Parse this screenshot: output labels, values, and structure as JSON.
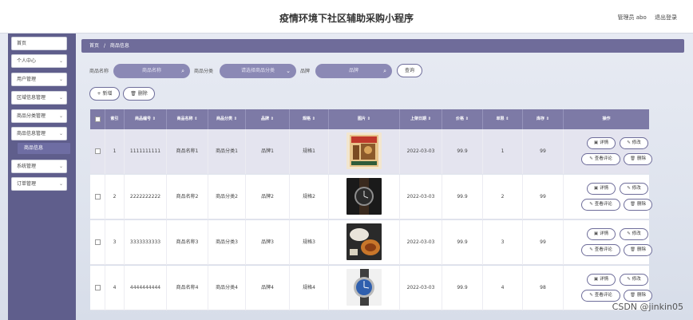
{
  "app": {
    "title": "疫情环境下社区辅助采购小程序",
    "admin": "管理员 abo",
    "logout": "退出登录"
  },
  "sidebar": {
    "items": [
      {
        "label": "首页",
        "chevron": ""
      },
      {
        "label": "个人中心",
        "chevron": "⌄"
      },
      {
        "label": "用户管理",
        "chevron": "⌄"
      },
      {
        "label": "区域信息管理",
        "chevron": "⌄"
      },
      {
        "label": "商品分类管理",
        "chevron": "⌄"
      },
      {
        "label": "商品信息管理",
        "chevron": "⌄"
      },
      {
        "label": "系统管理",
        "chevron": "⌄"
      },
      {
        "label": "订单管理",
        "chevron": "⌄"
      }
    ],
    "active_sub": "商品信息"
  },
  "breadcrumb": {
    "home": "首页",
    "sep": "/",
    "current": "商品信息"
  },
  "search": {
    "name_label": "商品名称",
    "name_placeholder": "商品名称",
    "cat_label": "商品分类",
    "cat_placeholder": "请选择商品分类",
    "brand_label": "品牌",
    "brand_placeholder": "品牌",
    "query": "查询",
    "search_icon": "⌕",
    "dropdown_icon": "⌄"
  },
  "actions": {
    "add": "+ 新增",
    "delete": "删除"
  },
  "table": {
    "headers": [
      "",
      "索引",
      "商品编号 ⇕",
      "商品名称 ⇕",
      "商品分类 ⇕",
      "品牌 ⇕",
      "规格 ⇕",
      "图片 ⇕",
      "上架日期 ⇕",
      "价格 ⇕",
      "单限 ⇕",
      "库存 ⇕",
      "操作"
    ],
    "rows": [
      {
        "index": "1",
        "code": "1111111111",
        "name": "商品名称1",
        "category": "商品分类1",
        "brand": "品牌1",
        "spec": "规格1",
        "date": "2022-03-03",
        "price": "99.9",
        "limit": "1",
        "stock": "99",
        "image": "book"
      },
      {
        "index": "2",
        "code": "2222222222",
        "name": "商品名称2",
        "category": "商品分类2",
        "brand": "品牌2",
        "spec": "规格2",
        "date": "2022-03-03",
        "price": "99.9",
        "limit": "2",
        "stock": "99",
        "image": "watch"
      },
      {
        "index": "3",
        "code": "3333333333",
        "name": "商品名称3",
        "category": "商品分类3",
        "brand": "品牌3",
        "spec": "规格3",
        "date": "2022-03-03",
        "price": "99.9",
        "limit": "3",
        "stock": "99",
        "image": "food"
      },
      {
        "index": "4",
        "code": "4444444444",
        "name": "商品名称4",
        "category": "商品分类4",
        "brand": "品牌4",
        "spec": "规格4",
        "date": "2022-03-03",
        "price": "99.9",
        "limit": "4",
        "stock": "98",
        "image": "bluewatch"
      }
    ],
    "ops": {
      "detail": "详情",
      "edit": "修改",
      "comments": "查看评论",
      "delete": "删除"
    }
  },
  "watermark": "CSDN @jinkin05",
  "colors": {
    "accent": "#6f6c9a",
    "sidebar": "#5f5e8c",
    "header": "#7d7aa6"
  }
}
